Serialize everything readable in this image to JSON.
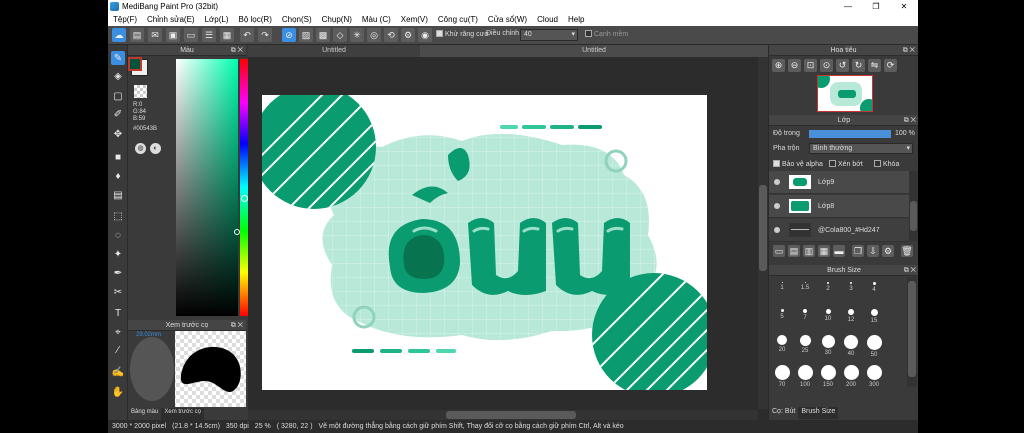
{
  "window": {
    "title": "MediBang Paint Pro (32bit)",
    "controls": [
      "—",
      "❐",
      "✕"
    ]
  },
  "menu": [
    "Tệp(F)",
    "Chỉnh sửa(E)",
    "Lớp(L)",
    "Bộ lọc(R)",
    "Chọn(S)",
    "Chụp(N)",
    "Màu (C)",
    "Xem(V)",
    "Công cụ(T)",
    "Cửa sổ(W)",
    "Cloud",
    "Help"
  ],
  "toolbar": {
    "antialias_label": "Khử răng cưa",
    "correction_label": "Điều chỉnh",
    "correction_value": "40",
    "snap_label": "Cạnh mềm"
  },
  "color_panel": {
    "title": "Màu",
    "rgb": "R:0\nG:84\nB:59",
    "hex": "#00543B",
    "colors": {
      "current": "#00543b",
      "hue_top": "#ff0000"
    }
  },
  "preview_panel": {
    "title": "Xem trước cọ",
    "size_label": "29.02mm",
    "tabs": [
      "Bảng màu",
      "Xem trước cọ"
    ]
  },
  "canvas": {
    "tabs": [
      "Untitled",
      "Untitled"
    ],
    "colors": {
      "green": "#0a9b70",
      "light": "#b8e8d8",
      "mint": "#9bdcc6"
    }
  },
  "navigator": {
    "title": "Hoa tiêu"
  },
  "layer_panel": {
    "title": "Lớp",
    "opacity_label": "Độ trong",
    "opacity_value": "100 %",
    "blend_label": "Pha trộn",
    "blend_value": "Bình thường",
    "protect_alpha": "Bảo vệ alpha",
    "clipping": "Xén bớt",
    "lock": "Khóa",
    "layers": [
      "Lớp9",
      "Lớp8",
      "@Cola800_#Hd247"
    ]
  },
  "brush_size": {
    "title": "Brush Size",
    "sizes": [
      "1",
      "1.5",
      "2",
      "3",
      "4",
      "5",
      "7",
      "10",
      "12",
      "15",
      "20",
      "25",
      "30",
      "40",
      "50",
      "70",
      "100",
      "150",
      "200",
      "300"
    ],
    "tabs": [
      "Cọ: Bút",
      "Brush Size"
    ]
  },
  "status": {
    "size": "3000 * 2000 pixel",
    "dims": "(21.8 * 14.5cm)",
    "dpi": "350 dpi",
    "zoom": "25 %",
    "coords": "( 3280, 22 )",
    "hint": "Vẽ một đường thẳng bằng cách giữ phím Shift, Thay đổi cỡ cọ bằng cách giữ phím Ctrl, Alt và kéo"
  }
}
